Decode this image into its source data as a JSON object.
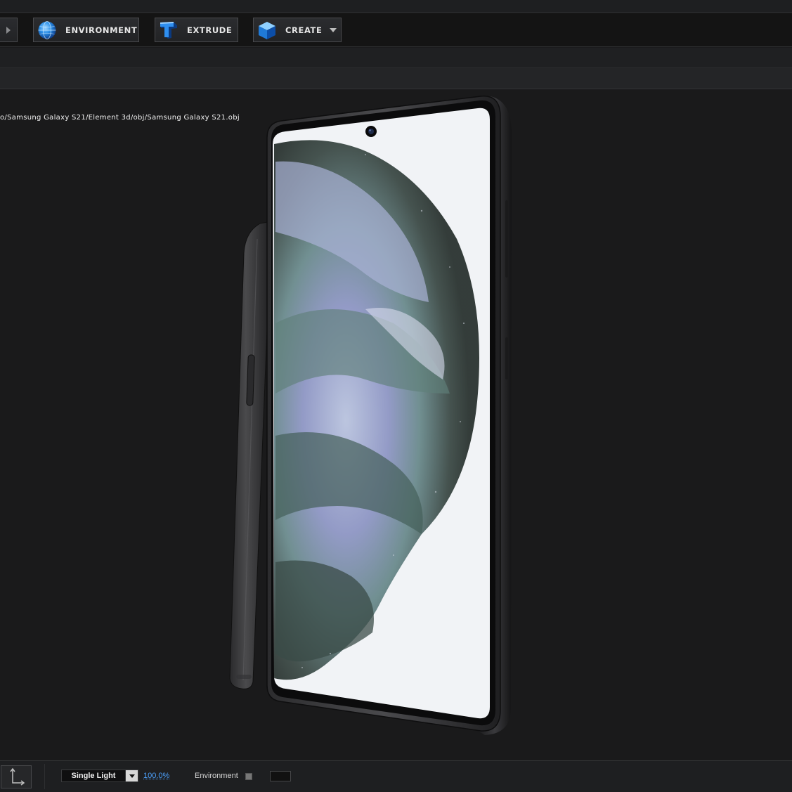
{
  "toolbar": {
    "environment_label": "ENVIRONMENT",
    "extrude_label": "EXTRUDE",
    "create_label": "CREATE"
  },
  "viewport": {
    "file_path": "o/Samsung Galaxy S21/Element 3d/obj/Samsung Galaxy S21.obj"
  },
  "statusbar": {
    "light_mode": "Single Light",
    "light_percent": "100.0%",
    "environment_label": "Environment"
  },
  "icons": {
    "environment": "globe-icon",
    "extrude": "extrude-t-icon",
    "create": "cube-icon",
    "axis": "axis-icon"
  },
  "colors": {
    "percent_link": "#4da3ff",
    "icon_blue": "#2b8fe8"
  }
}
